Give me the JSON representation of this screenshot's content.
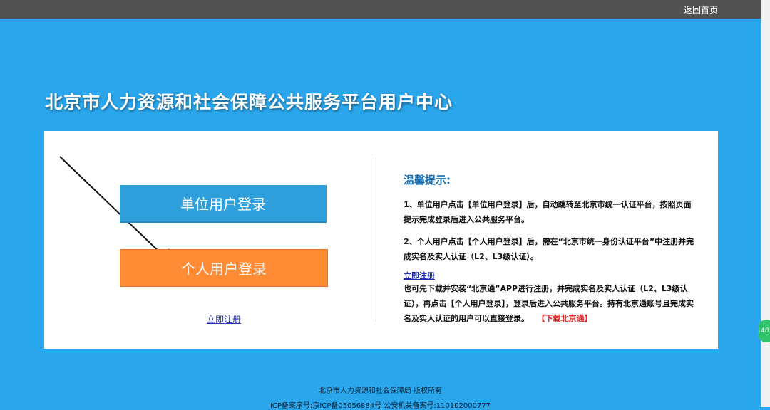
{
  "topbar": {
    "home_link": "返回首页"
  },
  "page": {
    "title": "北京市人力资源和社会保障公共服务平台用户中心"
  },
  "login": {
    "unit_button": "单位用户登录",
    "person_button": "个人用户登录",
    "register_link": "立即注册"
  },
  "tips": {
    "heading": "温馨提示:",
    "p1": "1、单位用户点击【单位用户登录】后，自动跳转至北京市统一认证平台，按照页面提示完成登录后进入公共服务平台。",
    "p2": "2、个人用户点击【个人用户登录】后，需在“北京市统一身份认证平台”中注册并完成实名及实人认证（L2、L3级认证）。",
    "register_link": "立即注册",
    "p3": "也可先下载并安装“北京通”APP进行注册，并完成实名及实人认证（L2、L3级认证），再点击【个人用户登录】，登录后进入公共服务平台。持有北京通账号且完成实名及实人认证的用户可以直接登录。",
    "download_link": "【下载北京通】"
  },
  "footer": {
    "copyright": "北京市人力资源和社会保障局 版权所有",
    "icp": "ICP备案序号:京ICP备05056884号 公安机关备案号:110102000777"
  },
  "side_widget": {
    "label": "48"
  },
  "colors": {
    "background": "#2aa6ec",
    "topbar": "#525252",
    "unit_button": "#2f9fdb",
    "person_button": "#ff8c35",
    "tips_heading": "#1a6fb2",
    "download_link": "#e52121"
  }
}
